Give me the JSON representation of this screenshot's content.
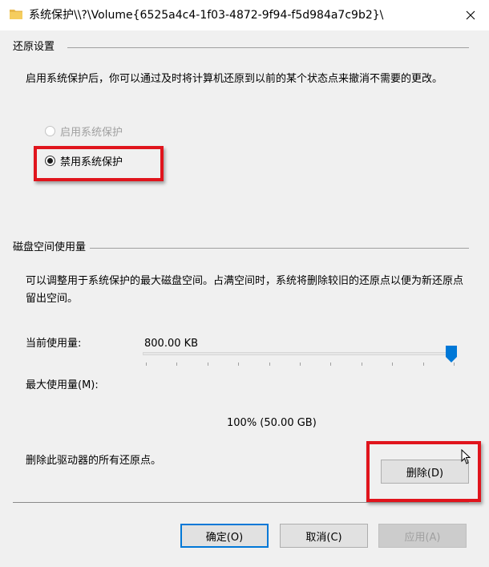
{
  "window": {
    "title": "系统保护\\\\?\\Volume{6525a4c4-1f03-4872-9f94-f5d984a7c9b2}\\"
  },
  "restore": {
    "heading": "还原设置",
    "description": "启用系统保护后，你可以通过及时将计算机还原到以前的某个状态点来撤消不需要的更改。",
    "options": [
      {
        "label": "启用系统保护",
        "selected": false,
        "disabled": true
      },
      {
        "label": "禁用系统保护",
        "selected": true,
        "disabled": false
      }
    ]
  },
  "disk": {
    "heading": "磁盘空间使用量",
    "description": "可以调整用于系统保护的最大磁盘空间。占满空间时，系统将删除较旧的还原点以便为新还原点留出空间。",
    "current_label": "当前使用量:",
    "current_value": "800.00 KB",
    "max_label": "最大使用量(M):",
    "max_percent": 100,
    "max_value_text": "100% (50.00 GB)",
    "delete_text": "删除此驱动器的所有还原点。",
    "delete_button": "删除(D)"
  },
  "buttons": {
    "ok": "确定(O)",
    "cancel": "取消(C)",
    "apply": "应用(A)"
  },
  "colors": {
    "highlight": "#e0141c",
    "accent": "#0078d7",
    "folder": "#e8b84a"
  }
}
